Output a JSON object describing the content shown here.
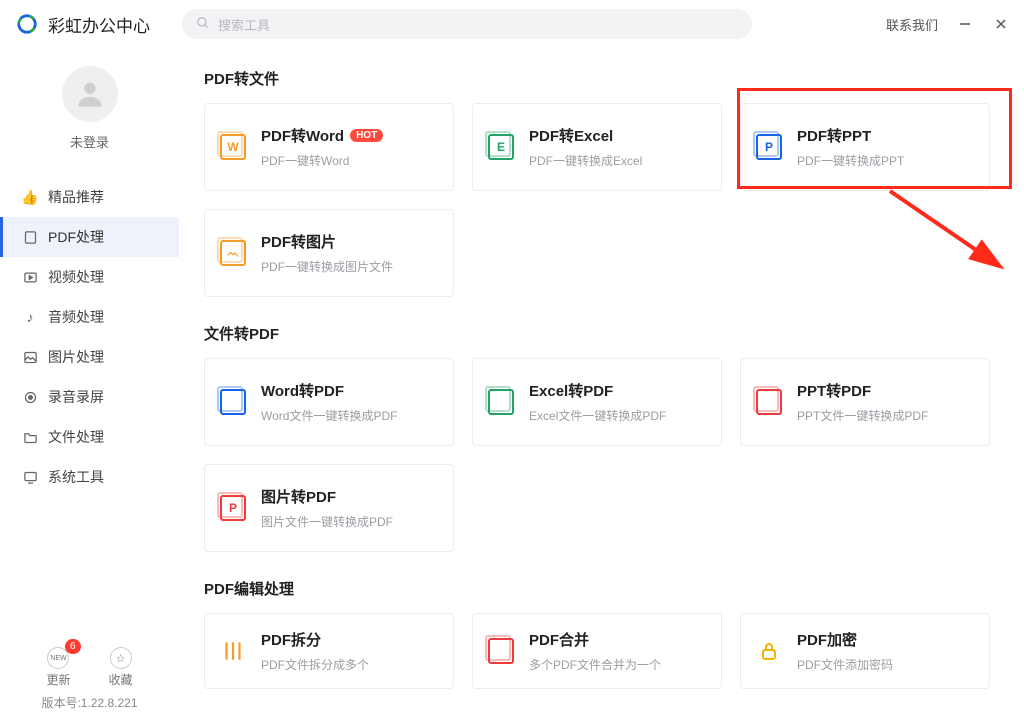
{
  "app": {
    "title": "彩虹办公中心"
  },
  "search": {
    "placeholder": "搜索工具"
  },
  "titlebar": {
    "contact": "联系我们"
  },
  "user": {
    "status": "未登录"
  },
  "nav": [
    {
      "label": "精品推荐"
    },
    {
      "label": "PDF处理"
    },
    {
      "label": "视频处理"
    },
    {
      "label": "音频处理"
    },
    {
      "label": "图片处理"
    },
    {
      "label": "录音录屏"
    },
    {
      "label": "文件处理"
    },
    {
      "label": "系统工具"
    }
  ],
  "nav_active_index": 1,
  "bottom": {
    "update": "更新",
    "favorites": "收藏",
    "badge": "6",
    "new": "NEW",
    "version": "版本号:1.22.8.221"
  },
  "sections": [
    {
      "title": "PDF转文件",
      "cards": [
        {
          "title": "PDF转Word",
          "sub": "PDF一键转Word",
          "hot": "HOT",
          "color": "#f59b2a",
          "letter": "W"
        },
        {
          "title": "PDF转Excel",
          "sub": "PDF一键转换成Excel",
          "color": "#1fa463",
          "letter": "E"
        },
        {
          "title": "PDF转PPT",
          "sub": "PDF一键转换成PPT",
          "color": "#1763e6",
          "letter": "P"
        },
        {
          "title": "PDF转图片",
          "sub": "PDF一键转换成图片文件",
          "color": "#f59b2a",
          "letter": ""
        }
      ]
    },
    {
      "title": "文件转PDF",
      "cards": [
        {
          "title": "Word转PDF",
          "sub": "Word文件一键转换成PDF",
          "color": "#1763e6",
          "letter": ""
        },
        {
          "title": "Excel转PDF",
          "sub": "Excel文件一键转换成PDF",
          "color": "#1fa463",
          "letter": ""
        },
        {
          "title": "PPT转PDF",
          "sub": "PPT文件一键转换成PDF",
          "color": "#ef3b3b",
          "letter": ""
        },
        {
          "title": "图片转PDF",
          "sub": "图片文件一键转换成PDF",
          "color": "#ef3b3b",
          "letter": "P"
        }
      ]
    },
    {
      "title": "PDF编辑处理",
      "cards": [
        {
          "title": "PDF拆分",
          "sub": "PDF文件拆分成多个",
          "color": "#f59b2a",
          "letter": ""
        },
        {
          "title": "PDF合并",
          "sub": "多个PDF文件合并为一个",
          "color": "#ef3b3b",
          "letter": ""
        },
        {
          "title": "PDF加密",
          "sub": "PDF文件添加密码",
          "color": "#f5b301",
          "letter": ""
        }
      ]
    }
  ]
}
